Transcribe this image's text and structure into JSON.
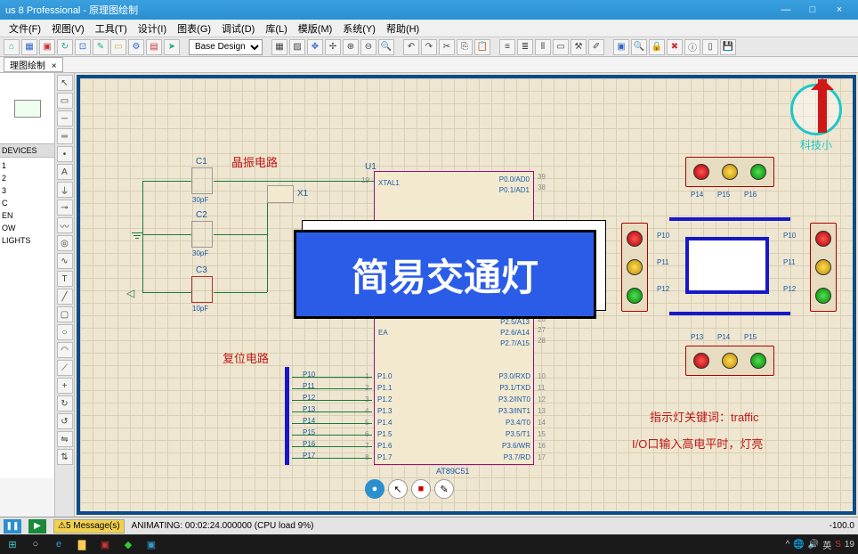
{
  "window": {
    "title": "us 8 Professional - 原理图绘制",
    "min": "—",
    "max": "□",
    "close": "×"
  },
  "menu": [
    "文件(F)",
    "视图(V)",
    "工具(T)",
    "设计(I)",
    "图表(G)",
    "调试(D)",
    "库(L)",
    "模版(M)",
    "系统(Y)",
    "帮助(H)"
  ],
  "toolbar2": {
    "design_mode": "Base Design"
  },
  "tab": {
    "name": "理图绘制",
    "close": "×"
  },
  "devices": {
    "header": "DEVICES",
    "items": [
      "1",
      "2",
      "3",
      "C",
      "EN",
      "OW",
      "LIGHTS"
    ]
  },
  "schematic": {
    "osc_title": "晶振电路",
    "reset_title": "复位电路",
    "c1": {
      "ref": "C1",
      "val": "30pF"
    },
    "c2": {
      "ref": "C2",
      "val": "30pF"
    },
    "c3": {
      "ref": "C3",
      "val": "10pF"
    },
    "x1": "X1",
    "u1": "U1",
    "chip_name": "AT89C51",
    "xtal1": "XTAL1",
    "p00": "P0.0/AD0",
    "p01": "P0.1/AD1",
    "ea": "EA",
    "p25": "P2.5/A13",
    "p26": "P2.6/A14",
    "p27": "P2.7/A15",
    "pins_left_low": [
      "P1.0",
      "P1.1",
      "P1.2",
      "P1.3",
      "P1.4",
      "P1.5",
      "P1.6",
      "P1.7"
    ],
    "pins_right_low": [
      "P3.0/RXD",
      "P3.1/TXD",
      "P3.2/INT0",
      "P3.3/INT1",
      "P3.4/T0",
      "P3.5/T1",
      "P3.6/WR",
      "P3.7/RD"
    ],
    "pinno_left": [
      "1",
      "2",
      "3",
      "4",
      "5",
      "6",
      "7",
      "8"
    ],
    "pinno_p0": [
      "39",
      "38"
    ],
    "pinno_p2": [
      "26",
      "27",
      "28"
    ],
    "pinno_p3": [
      "10",
      "11",
      "12",
      "13",
      "14",
      "15",
      "16",
      "17"
    ],
    "bus_labels_l": [
      "P10",
      "P11",
      "P12",
      "P13",
      "P14",
      "P15",
      "P16",
      "P17"
    ],
    "seg_bus_top": [
      "P14",
      "P15",
      "P16"
    ],
    "seg_bus_bot": [
      "P13",
      "P14",
      "P15"
    ],
    "seg_bus_r": [
      "P10",
      "P11",
      "P12"
    ],
    "note1": "指示灯关键词：traffic",
    "note2": "I/O口输入高电平时，灯亮",
    "overlay": "简易交通灯",
    "logo_text": "科技小"
  },
  "status": {
    "messages": "5 Message(s)",
    "anim": "ANIMATING: 00:02:24.000000 (CPU load 9%)",
    "coord": "-100.0"
  },
  "taskbar": {
    "time": "19"
  }
}
